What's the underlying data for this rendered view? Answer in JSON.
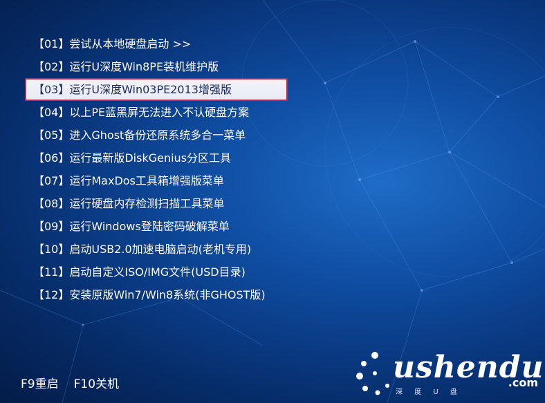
{
  "menu": {
    "items": [
      {
        "label": "【01】尝试从本地硬盘启动 >>"
      },
      {
        "label": "【02】运行U深度Win8PE装机维护版"
      },
      {
        "label": "【03】运行U深度Win03PE2013增强版"
      },
      {
        "label": "【04】以上PE蓝黑屏无法进入不认硬盘方案"
      },
      {
        "label": "【05】进入Ghost备份还原系统多合一菜单"
      },
      {
        "label": "【06】运行最新版DiskGenius分区工具"
      },
      {
        "label": "【07】运行MaxDos工具箱增强版菜单"
      },
      {
        "label": "【08】运行硬盘内存检测扫描工具菜单"
      },
      {
        "label": "【09】运行Windows登陆密码破解菜单"
      },
      {
        "label": "【10】启动USB2.0加速电脑启动(老机专用)"
      },
      {
        "label": "【11】启动自定义ISO/IMG文件(USD目录)"
      },
      {
        "label": "【12】安装原版Win7/Win8系统(非GHOST版)"
      }
    ],
    "selected_index": 2
  },
  "footer": {
    "f9_label": "F9重启",
    "f10_label": "F10关机"
  },
  "logo": {
    "text": "ushendu",
    "subtext": "深 度 U 盘",
    "com": ".com"
  },
  "colors": {
    "background": "#0a3a83",
    "highlight_bg": "#eceef6",
    "highlight_border": "#b42c48",
    "highlight_text": "#1c2a5a",
    "text": "#ffffff"
  }
}
